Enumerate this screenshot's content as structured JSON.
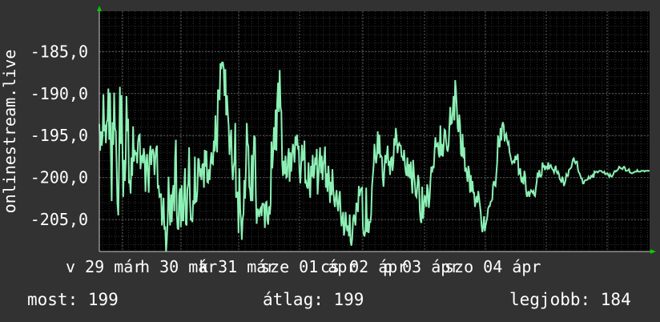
{
  "chart_data": {
    "type": "line",
    "ylabel": "onlinestream.live",
    "ylim": [
      -208.8,
      -180.2
    ],
    "y_ticks": [
      -185.0,
      -190.0,
      -195.0,
      -200.0,
      -205.0
    ],
    "y_tick_labels": [
      "-185,0",
      "-190,0",
      "-195,0",
      "-200,0",
      "-205,0"
    ],
    "x_tick_labels": [
      "v 29 már",
      "h 30 már",
      "k 31 már",
      "sze 01 ápr",
      "cs 02 ápr",
      "p 03 ápr",
      "szo 04 ápr"
    ],
    "grid": true,
    "colors": {
      "line": "#8cf0b4",
      "background": "#000000",
      "grid_major": "#5a5a5a",
      "grid_minor": "#303030",
      "axis_arrow": "#00cc00"
    },
    "series": [
      {
        "values": [
          -193.6,
          -196.8,
          -194.5,
          -196.2,
          -195.0,
          -190.1,
          -194.5,
          -193.7,
          -195.9,
          -193.4,
          -193.1,
          -189.4,
          -195.5,
          -189.9,
          -196.7,
          -202.8,
          -193.4,
          -196.1,
          -189.9,
          -194.1,
          -194.5,
          -198.3,
          -203.1,
          -204.5,
          -197.9,
          -189.2,
          -196.0,
          -190.2,
          -196.0,
          -202.3,
          -197.9,
          -200.4,
          -198.1,
          -190.3,
          -194.5,
          -193.0,
          -200.7,
          -200.3,
          -201.9,
          -197.6,
          -199.8,
          -193.9,
          -198.1,
          -196.7,
          -197.3,
          -197.0,
          -198.3,
          -195.8,
          -195.0,
          -194.9,
          -199.0,
          -197.5,
          -197.4,
          -198.3,
          -196.5,
          -197.6,
          -201.7,
          -198.3,
          -197.2,
          -199.8,
          -201.8,
          -197.4,
          -196.2,
          -198.5,
          -197.0,
          -196.6,
          -197.1,
          -199.7,
          -197.7,
          -196.5,
          -196.2,
          -201.3,
          -200.9,
          -202.3,
          -202.2,
          -201.9,
          -205.7,
          -204.5,
          -202.4,
          -206.2,
          -205.8,
          -209.0,
          -207.4,
          -205.0,
          -199.9,
          -203.2,
          -205.7,
          -202.0,
          -205.3,
          -201.8,
          -200.9,
          -204.0,
          -197.8,
          -195.5,
          -204.3,
          -206.0,
          -206.2,
          -202.0,
          -201.3,
          -205.9,
          -200.9,
          -205.1,
          -205.1,
          -201.4,
          -198.9,
          -205.5,
          -205.7,
          -201.4,
          -200.7,
          -196.4,
          -202.5,
          -205.1,
          -204.8,
          -205.3,
          -202.7,
          -203.2,
          -197.5,
          -202.9,
          -202.8,
          -201.6,
          -197.7,
          -197.9,
          -199.9,
          -198.9,
          -200.3,
          -198.5,
          -198.3,
          -201.2,
          -196.7,
          -198.7,
          -196.8,
          -200.5,
          -200.6,
          -199.0,
          -200.3,
          -198.2,
          -197.0,
          -198.3,
          -198.4,
          -195.6,
          -196.9,
          -192.6,
          -195.8,
          -197.0,
          -189.6,
          -189.6,
          -190.8,
          -186.4,
          -187.1,
          -186.3,
          -186.3,
          -187.0,
          -190.3,
          -187.1,
          -192.6,
          -190.2,
          -192.3,
          -193.9,
          -197.3,
          -195.6,
          -194.3,
          -198.3,
          -200.3,
          -198.8,
          -198.1,
          -193.5,
          -202.4,
          -202.0,
          -201.7,
          -206.6,
          -198.9,
          -203.8,
          -205.1,
          -207.4,
          -205.0,
          -204.3,
          -200.3,
          -202.5,
          -198.7,
          -193.5,
          -195.9,
          -196.3,
          -201.1,
          -201.4,
          -202.8,
          -197.3,
          -202.8,
          -197.8,
          -195.0,
          -195.3,
          -202.0,
          -205.5,
          -203.7,
          -204.0,
          -204.7,
          -203.8,
          -203.6,
          -204.6,
          -203.1,
          -203.1,
          -203.3,
          -206.0,
          -203.0,
          -202.9,
          -205.1,
          -205.6,
          -203.4,
          -204.4,
          -203.1,
          -195.7,
          -198.9,
          -197.1,
          -194.0,
          -196.7,
          -191.9,
          -196.8,
          -190.9,
          -188.7,
          -192.2,
          -187.2,
          -191.6,
          -192.2,
          -198.2,
          -199.8,
          -198.0,
          -199.6,
          -197.4,
          -200.0,
          -199.9,
          -197.7,
          -196.5,
          -200.5,
          -197.0,
          -199.3,
          -197.3,
          -196.0,
          -196.6,
          -198.2,
          -195.1,
          -196.2,
          -194.9,
          -196.4,
          -196.2,
          -199.3,
          -200.7,
          -198.4,
          -196.1,
          -197.9,
          -197.8,
          -195.6,
          -200.7,
          -200.5,
          -201.1,
          -201.3,
          -198.2,
          -201.0,
          -202.4,
          -198.6,
          -199.9,
          -197.3,
          -200.1,
          -199.5,
          -197.6,
          -198.5,
          -196.6,
          -202.0,
          -200.1,
          -198.0,
          -196.4,
          -199.5,
          -197.4,
          -200.3,
          -198.5,
          -197.8,
          -196.3,
          -201.2,
          -199.5,
          -201.7,
          -198.6,
          -200.0,
          -203.0,
          -200.5,
          -202.1,
          -199.0,
          -201.4,
          -202.7,
          -203.5,
          -202.3,
          -201.5,
          -203.2,
          -204.0,
          -202.5,
          -201.6,
          -204.1,
          -205.8,
          -205.0,
          -204.1,
          -206.9,
          -206.1,
          -204.1,
          -205.6,
          -206.4,
          -205.7,
          -207.0,
          -204.4,
          -207.6,
          -208.1,
          -207.3,
          -205.0,
          -204.4,
          -205.0,
          -205.7,
          -203.0,
          -203.2,
          -204.1,
          -201.0,
          -202.2,
          -201.6,
          -201.3,
          -201.2,
          -205.9,
          -206.8,
          -206.9,
          -206.3,
          -201.2,
          -206.5,
          -204.9,
          -206.6,
          -205.3,
          -205.3,
          -204.4,
          -201.1,
          -199.9,
          -198.5,
          -196.0,
          -197.5,
          -198.3,
          -197.3,
          -194.5,
          -197.2,
          -194.9,
          -197.5,
          -197.4,
          -197.6,
          -200.0,
          -201.1,
          -199.2,
          -197.3,
          -198.3,
          -197.4,
          -196.2,
          -198.6,
          -198.0,
          -199.7,
          -197.7,
          -197.6,
          -199.2,
          -198.0,
          -195.3,
          -196.2,
          -194.1,
          -195.3,
          -197.1,
          -196.1,
          -195.9,
          -196.2,
          -196.2,
          -197.5,
          -197.5,
          -198.0,
          -196.7,
          -198.5,
          -199.4,
          -199.8,
          -197.6,
          -199.9,
          -198.4,
          -200.1,
          -198.1,
          -200.4,
          -201.9,
          -197.9,
          -199.6,
          -200.6,
          -202.1,
          -202.3,
          -201.1,
          -199.7,
          -200.5,
          -203.9,
          -205.1,
          -205.4,
          -201.1,
          -204.9,
          -203.6,
          -202.1,
          -202.5,
          -203.5,
          -200.8,
          -201.5,
          -203.6,
          -202.4,
          -200.4,
          -198.7,
          -199.4,
          -198.6,
          -198.9,
          -196.8,
          -195.2,
          -196.4,
          -196.0,
          -195.9,
          -197.2,
          -197.6,
          -193.8,
          -197.4,
          -196.0,
          -197.5,
          -196.2,
          -194.3,
          -194.4,
          -195.7,
          -196.6,
          -196.9,
          -196.1,
          -193.8,
          -191.6,
          -193.6,
          -193.5,
          -192.2,
          -190.3,
          -193.2,
          -188.4,
          -189.6,
          -191.6,
          -194.1,
          -194.6,
          -192.5,
          -193.9,
          -197.2,
          -197.5,
          -194.8,
          -197.7,
          -196.4,
          -199.3,
          -198.8,
          -199.5,
          -200.5,
          -198.6,
          -199.3,
          -201.8,
          -199.7,
          -201.7,
          -200.4,
          -201.8,
          -201.8,
          -203.5,
          -202.8,
          -202.2,
          -203.0,
          -201.6,
          -202.4,
          -203.2,
          -204.2,
          -205.7,
          -206.5,
          -205.8,
          -204.6,
          -206.4,
          -205.7,
          -205.2,
          -204.7,
          -203.7,
          -203.4,
          -203.4,
          -202.9,
          -202.8,
          -202.6,
          -200.9,
          -200.4,
          -200.9,
          -201.0,
          -199.5,
          -198.2,
          -195.0,
          -196.1,
          -196.4,
          -194.1,
          -195.6,
          -193.8,
          -193.4,
          -193.9,
          -195.7,
          -195.0,
          -194.8,
          -195.6,
          -196.0,
          -195.8,
          -197.0,
          -197.4,
          -197.9,
          -198.3,
          -198.1,
          -198.0,
          -198.3,
          -197.4,
          -197.9,
          -197.6,
          -197.2,
          -199.6,
          -199.5,
          -198.9,
          -200.3,
          -200.6,
          -199.9,
          -200.8,
          -199.2,
          -199.8,
          -201.5,
          -202.3,
          -201.9,
          -201.6,
          -202.3,
          -201.8,
          -201.5,
          -201.6,
          -201.8,
          -201.6,
          -202.1,
          -202.2,
          -201.2,
          -200.5,
          -199.4,
          -200.0,
          -199.1,
          -199.8,
          -199.9,
          -199.7,
          -198.2,
          -198.8,
          -198.5,
          -199.1,
          -198.7,
          -198.7,
          -198.9,
          -198.2,
          -199.0,
          -198.6,
          -198.5,
          -198.8,
          -199.0,
          -199.1,
          -199.4,
          -199.0,
          -198.6,
          -199.3,
          -199.5,
          -199.3,
          -199.6,
          -200.2,
          -200.3,
          -200.6,
          -199.9,
          -200.2,
          -201.0,
          -200.7,
          -200.3,
          -199.6,
          -199.8,
          -199.8,
          -199.1,
          -199.0,
          -198.9,
          -198.8,
          -198.3,
          -197.8,
          -197.7,
          -198.1,
          -198.3,
          -198.1,
          -198.1,
          -199.0,
          -199.4,
          -199.5,
          -199.8,
          -200.1,
          -200.1,
          -200.7,
          -200.7,
          -200.4,
          -200.3,
          -200.3,
          -200.3,
          -200.2,
          -199.9,
          -200.1,
          -200.1,
          -199.8,
          -199.9,
          -199.7,
          -200.0,
          -199.3,
          -199.4,
          -199.3,
          -199.3,
          -199.4,
          -199.3,
          -199.2,
          -199.2,
          -199.2,
          -199.3,
          -199.4,
          -199.4,
          -199.3,
          -199.6,
          -199.6,
          -199.5,
          -199.5,
          -199.7,
          -199.9,
          -199.6,
          -199.8,
          -199.9,
          -199.8,
          -199.6,
          -199.3,
          -199.2,
          -199.3,
          -199.2,
          -199.1,
          -199.0,
          -198.7,
          -198.8,
          -198.9,
          -198.9,
          -199.0,
          -198.8,
          -198.7,
          -198.8,
          -199.2,
          -199.2,
          -199.2,
          -199.1,
          -199.0,
          -199.4,
          -199.4,
          -199.5,
          -199.5,
          -199.4,
          -199.4,
          -199.3,
          -199.3,
          -199.3,
          -199.1,
          -199.3,
          -199.3,
          -199.3,
          -199.3,
          -199.2,
          -199.2,
          -199.2,
          -199.2,
          -199.3,
          -199.2,
          -199.2,
          -199.2,
          -199.2,
          -199.2,
          -199.2
        ]
      }
    ]
  },
  "stats": {
    "current": "most: 199",
    "average": "átlag: 199",
    "best": "legjobb: 184"
  }
}
